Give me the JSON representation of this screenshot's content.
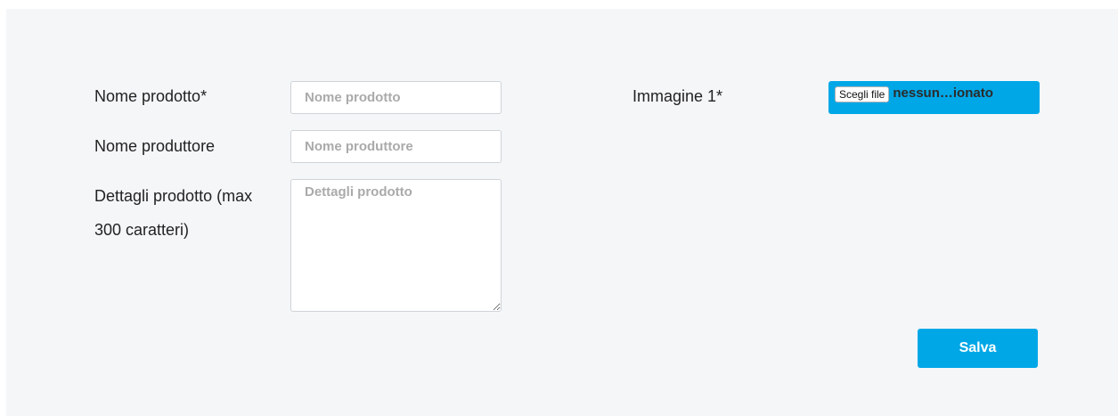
{
  "form": {
    "product_name": {
      "label": "Nome prodotto*",
      "placeholder": "Nome prodotto",
      "value": ""
    },
    "manufacturer_name": {
      "label": "Nome produttore",
      "placeholder": "Nome produttore",
      "value": ""
    },
    "product_details": {
      "label_line1": "Dettagli prodotto (max",
      "label_line2": "300 caratteri)",
      "placeholder": "Dettagli prodotto",
      "value": ""
    },
    "image1": {
      "label": "Immagine 1*",
      "choose_label": "Scegli file",
      "status": "nessun…ionato"
    },
    "save_label": "Salva"
  },
  "colors": {
    "accent": "#00a7e7",
    "panel_bg": "#f4f6f8"
  }
}
